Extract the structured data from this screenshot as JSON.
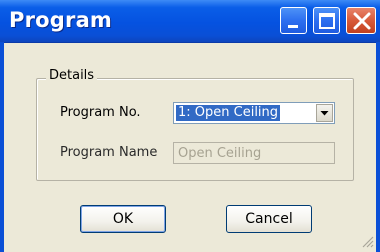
{
  "window": {
    "title": "Program",
    "colors": {
      "titlebar": "#0552e0",
      "close_button": "#d85a3a",
      "selection": "#316ac5"
    }
  },
  "details": {
    "legend": "Details",
    "program_no": {
      "label": "Program No.",
      "selected": "1: Open Ceiling"
    },
    "program_name": {
      "label": "Program Name",
      "value": "Open Ceiling"
    }
  },
  "buttons": {
    "ok": "OK",
    "cancel": "Cancel"
  },
  "icons": [
    "minimize-icon",
    "maximize-icon",
    "close-icon",
    "dropdown-arrow-icon",
    "resize-grip-icon"
  ]
}
